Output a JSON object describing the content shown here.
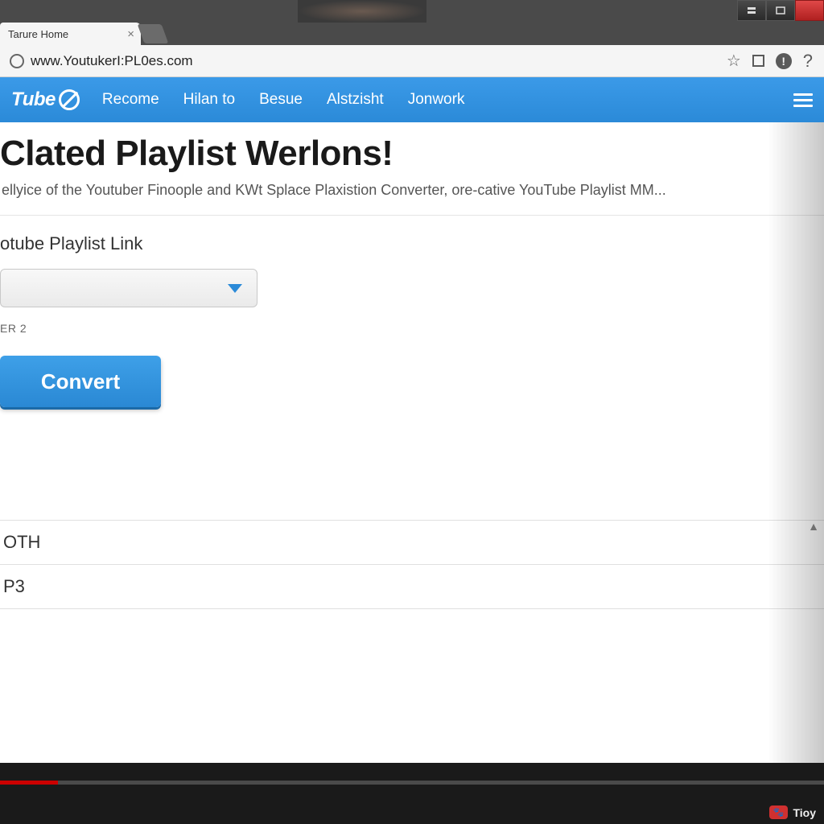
{
  "browser": {
    "tab_title": "Tarure Home",
    "url": "www.YoutukerI:PL0es.com"
  },
  "nav": {
    "logo_text": "Tube",
    "links": [
      "Recome",
      "Hilan to",
      "Besue",
      "Alstzisht",
      "Jonwork"
    ]
  },
  "page": {
    "heading": "Clated Playlist Werlons!",
    "subtext": "ellyice of the Youtuber Finoople and KWt Splace Plaxistion Converter, ore-cative YouTube Playlist MM...",
    "form_label": "otube Playlist Link",
    "small_label": "ER 2",
    "convert_label": "Convert"
  },
  "list": {
    "row1": "OTH",
    "row2": "P3"
  },
  "tray": {
    "badge_icon": "🐾",
    "label": "Tioy"
  }
}
